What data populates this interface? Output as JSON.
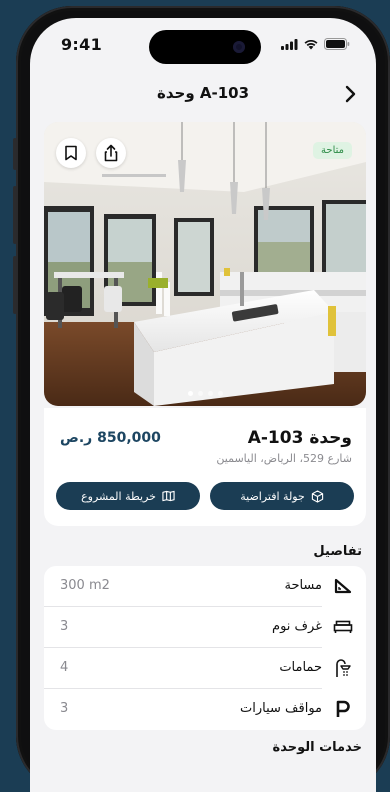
{
  "status_bar": {
    "time": "9:41"
  },
  "nav": {
    "title": "وحدة A-103"
  },
  "hero": {
    "badge": "متاحة",
    "slides": 4,
    "active_slide": 1
  },
  "unit": {
    "title": "وحدة A-103",
    "price": "850,000 ر.ص",
    "address": "شارع 529، الرياض، الياسمين"
  },
  "actions": {
    "virtual_tour": "جولة افتراضية",
    "project_map": "خريطة المشروع"
  },
  "details": {
    "title": "تفاصيل",
    "rows": [
      {
        "label": "مساحة",
        "value": "300 m2",
        "icon": "area-icon"
      },
      {
        "label": "غرف نوم",
        "value": "3",
        "icon": "bed-icon"
      },
      {
        "label": "حمامات",
        "value": "4",
        "icon": "shower-icon"
      },
      {
        "label": "مواقف سيارات",
        "value": "3",
        "icon": "parking-icon"
      }
    ]
  },
  "services": {
    "title": "خدمات الوحدة"
  },
  "colors": {
    "primary": "#1b3d54",
    "background": "#f3f3f5",
    "badge_bg": "#dff3e3",
    "badge_text": "#2e8c47"
  }
}
